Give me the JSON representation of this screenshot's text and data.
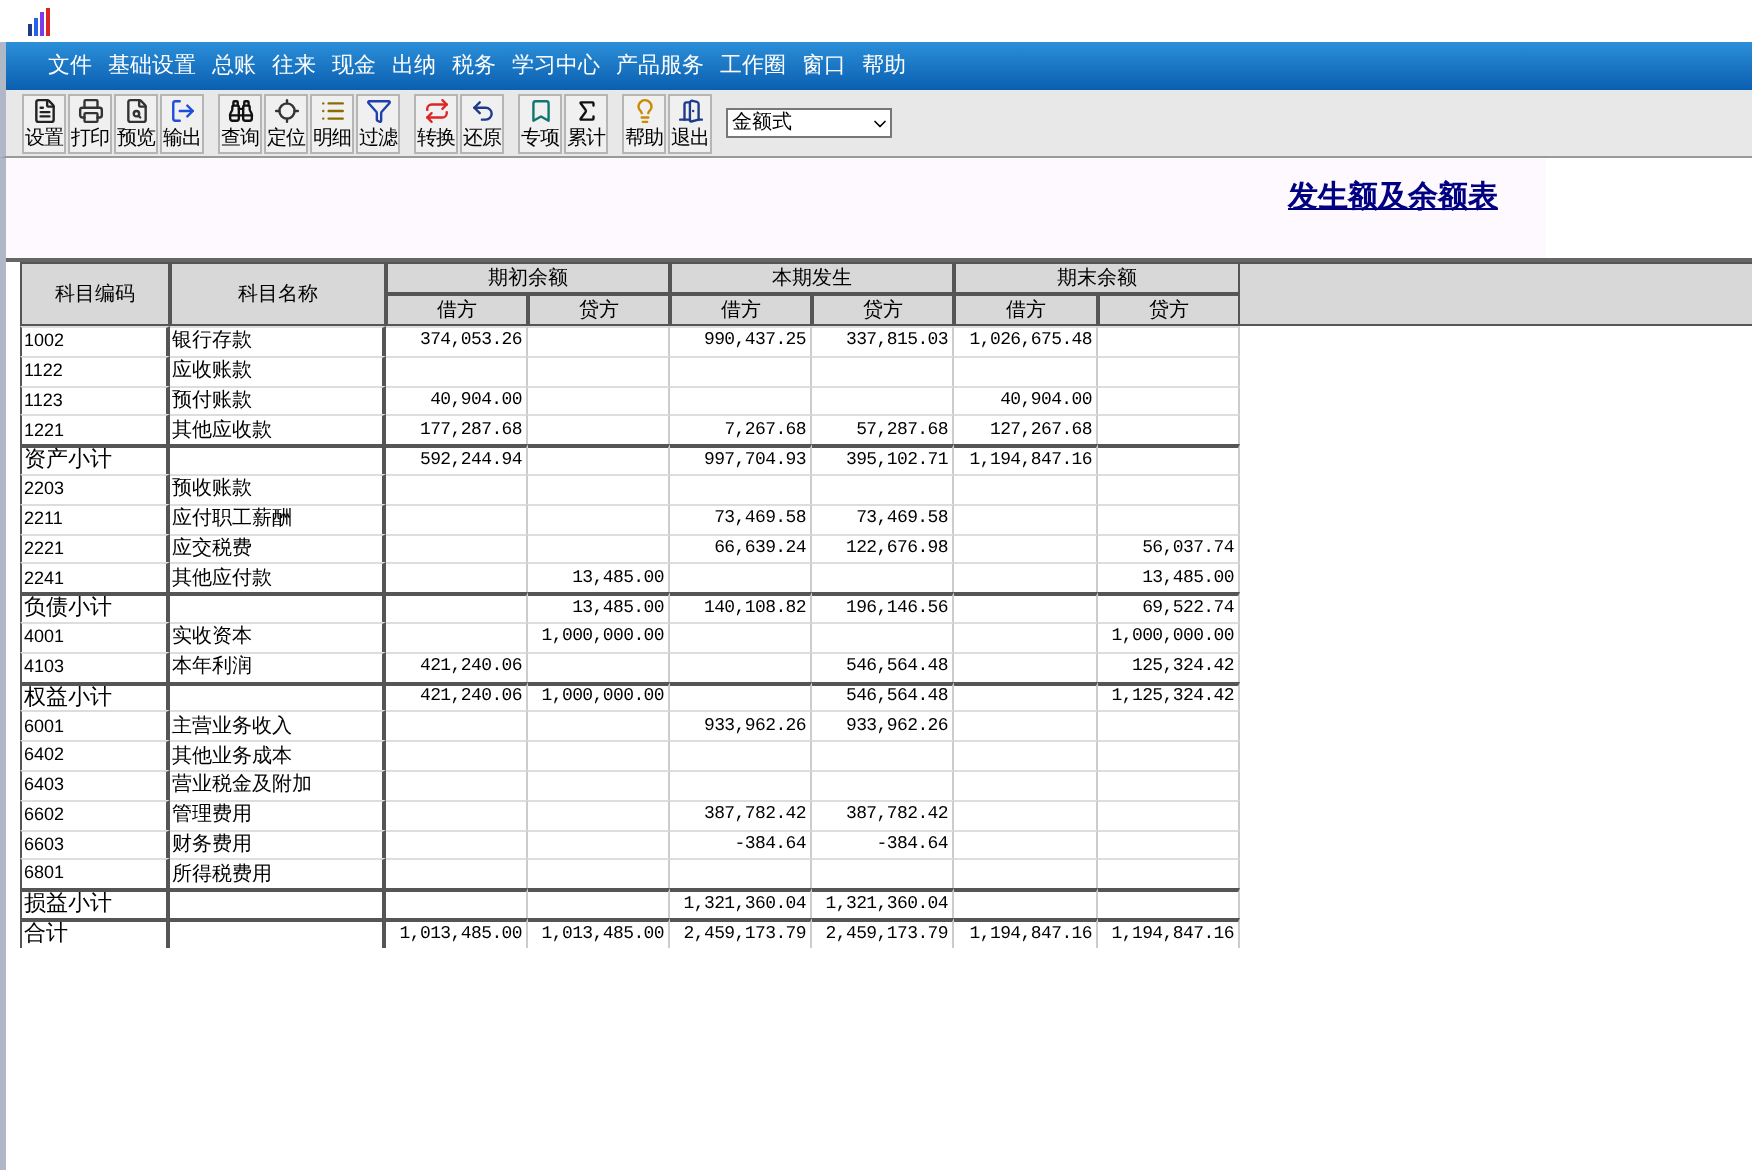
{
  "menu": [
    "文件",
    "基础设置",
    "总账",
    "往来",
    "现金",
    "出纳",
    "税务",
    "学习中心",
    "产品服务",
    "工作圈",
    "窗口",
    "帮助"
  ],
  "toolbar": {
    "groups": [
      [
        "设置",
        "打印",
        "预览",
        "输出"
      ],
      [
        "查询",
        "定位",
        "明细",
        "过滤"
      ],
      [
        "转换",
        "还原"
      ],
      [
        "专项",
        "累计"
      ],
      [
        "帮助",
        "退出"
      ]
    ],
    "format_select": {
      "value": "金额式"
    }
  },
  "report": {
    "title": "发生额及余额表"
  },
  "table": {
    "code_header": "科目编码",
    "name_header": "科目名称",
    "groups": [
      {
        "label": "期初余额",
        "columns": [
          "借方",
          "贷方"
        ]
      },
      {
        "label": "本期发生",
        "columns": [
          "借方",
          "贷方"
        ]
      },
      {
        "label": "期末余额",
        "columns": [
          "借方",
          "贷方"
        ]
      }
    ],
    "rows": [
      {
        "kind": "account",
        "code": "1002",
        "name": "银行存款",
        "opening_debit": "374,053.26",
        "period_debit": "990,437.25",
        "period_credit": "337,815.03",
        "closing_debit": "1,026,675.48"
      },
      {
        "kind": "account",
        "code": "1122",
        "name": "应收账款"
      },
      {
        "kind": "account",
        "code": "1123",
        "name": "预付账款",
        "opening_debit": "40,904.00",
        "closing_debit": "40,904.00"
      },
      {
        "kind": "account",
        "code": "1221",
        "name": "其他应收款",
        "opening_debit": "177,287.68",
        "period_debit": "7,267.68",
        "period_credit": "57,287.68",
        "closing_debit": "127,267.68"
      },
      {
        "kind": "subtotal",
        "code": "资产小计",
        "opening_debit": "592,244.94",
        "period_debit": "997,704.93",
        "period_credit": "395,102.71",
        "closing_debit": "1,194,847.16"
      },
      {
        "kind": "account",
        "code": "2203",
        "name": "预收账款"
      },
      {
        "kind": "account",
        "code": "2211",
        "name": "应付职工薪酬",
        "period_debit": "73,469.58",
        "period_credit": "73,469.58"
      },
      {
        "kind": "account",
        "code": "2221",
        "name": "应交税费",
        "period_debit": "66,639.24",
        "period_credit": "122,676.98",
        "closing_credit": "56,037.74"
      },
      {
        "kind": "account",
        "code": "2241",
        "name": "其他应付款",
        "opening_credit": "13,485.00",
        "closing_credit": "13,485.00"
      },
      {
        "kind": "subtotal",
        "code": "负债小计",
        "opening_credit": "13,485.00",
        "period_debit": "140,108.82",
        "period_credit": "196,146.56",
        "closing_credit": "69,522.74"
      },
      {
        "kind": "account",
        "code": "4001",
        "name": "实收资本",
        "opening_credit": "1,000,000.00",
        "closing_credit": "1,000,000.00"
      },
      {
        "kind": "account",
        "code": "4103",
        "name": "本年利润",
        "opening_debit": "421,240.06",
        "period_credit": "546,564.48",
        "closing_credit": "125,324.42"
      },
      {
        "kind": "subtotal",
        "code": "权益小计",
        "opening_debit": "421,240.06",
        "opening_credit": "1,000,000.00",
        "period_credit": "546,564.48",
        "closing_credit": "1,125,324.42"
      },
      {
        "kind": "account",
        "code": "6001",
        "name": "主营业务收入",
        "period_debit": "933,962.26",
        "period_credit": "933,962.26"
      },
      {
        "kind": "account",
        "code": "6402",
        "name": "其他业务成本"
      },
      {
        "kind": "account",
        "code": "6403",
        "name": "营业税金及附加"
      },
      {
        "kind": "account",
        "code": "6602",
        "name": "管理费用",
        "period_debit": "387,782.42",
        "period_credit": "387,782.42"
      },
      {
        "kind": "account",
        "code": "6603",
        "name": "财务费用",
        "period_debit": "-384.64",
        "period_credit": "-384.64"
      },
      {
        "kind": "account",
        "code": "6801",
        "name": "所得税费用"
      },
      {
        "kind": "subtotal",
        "code": "损益小计",
        "period_debit": "1,321,360.04",
        "period_credit": "1,321,360.04"
      },
      {
        "kind": "subtotal",
        "code": "合计",
        "opening_debit": "1,013,485.00",
        "opening_credit": "1,013,485.00",
        "period_debit": "2,459,173.79",
        "period_credit": "2,459,173.79",
        "closing_debit": "1,194,847.16",
        "closing_credit": "1,194,847.16"
      }
    ]
  }
}
